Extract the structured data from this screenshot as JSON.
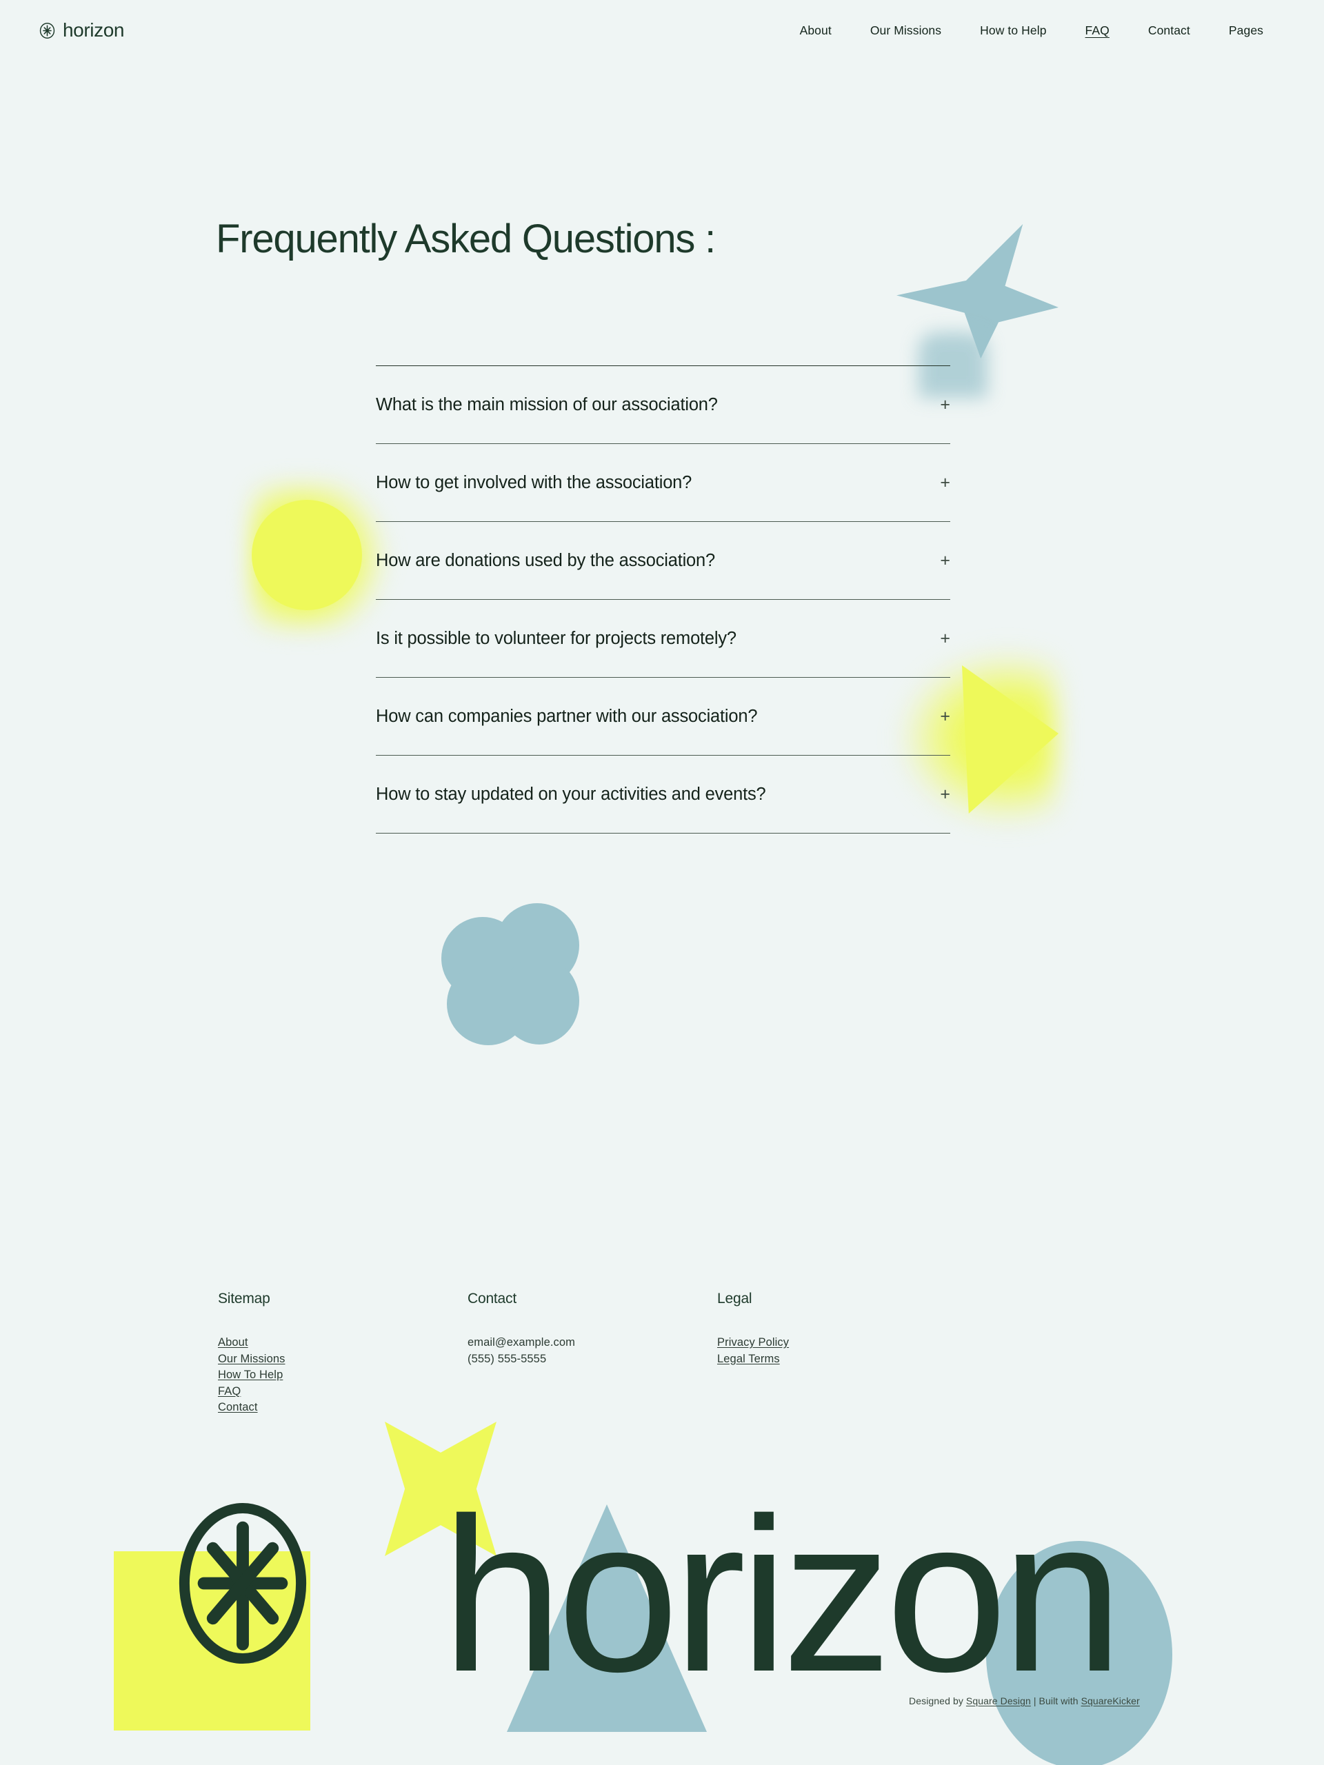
{
  "theme": {
    "background": "#eff5f4",
    "dark_green": "#1e3a2b",
    "text": "#14221a",
    "accent_yellow": "#eef95a",
    "accent_blue": "#9cc4cd",
    "rule": "#4b5a50"
  },
  "header": {
    "logo_icon": "circled-asterisk-icon",
    "brand": "horizon",
    "nav": [
      {
        "label": "About",
        "active": false
      },
      {
        "label": "Our Missions",
        "active": false
      },
      {
        "label": "How to Help",
        "active": false
      },
      {
        "label": "FAQ",
        "active": true
      },
      {
        "label": "Contact",
        "active": false
      },
      {
        "label": "Pages",
        "active": false
      }
    ]
  },
  "main": {
    "title": "Frequently Asked Questions :",
    "expand_icon": "+",
    "faq": [
      {
        "question": "What is the main mission of our association?"
      },
      {
        "question": "How to get involved with the association?"
      },
      {
        "question": "How are donations used by the association?"
      },
      {
        "question": "Is it possible to volunteer for projects remotely?"
      },
      {
        "question": "How can companies partner with our association?"
      },
      {
        "question": "How to stay updated on your activities and events?"
      }
    ]
  },
  "footer": {
    "columns": [
      {
        "heading": "Sitemap",
        "links": [
          {
            "label": "About"
          },
          {
            "label": "Our Missions"
          },
          {
            "label": "How To Help"
          },
          {
            "label": "FAQ"
          },
          {
            "label": "Contact"
          }
        ]
      },
      {
        "heading": "Contact",
        "lines": [
          {
            "label": "email@example.com"
          },
          {
            "label": "(555) 555-5555"
          }
        ]
      },
      {
        "heading": "Legal",
        "links": [
          {
            "label": "Privacy Policy"
          },
          {
            "label": "Legal Terms"
          }
        ]
      }
    ],
    "wordmark": "horizon",
    "wordmark_icon": "circled-asterisk-icon",
    "credits": {
      "prefix": "Designed by ",
      "designer": "Square Design",
      "separator": " | Built with ",
      "builder": "SquareKicker"
    }
  },
  "decorations": [
    {
      "name": "blue-star-shape"
    },
    {
      "name": "yellow-circle-shape"
    },
    {
      "name": "yellow-triangle-shape"
    },
    {
      "name": "blue-cloud-shape"
    },
    {
      "name": "yellow-square-shape"
    },
    {
      "name": "yellow-star-shape"
    },
    {
      "name": "blue-triangle-shape"
    },
    {
      "name": "blue-circle-shape"
    }
  ]
}
